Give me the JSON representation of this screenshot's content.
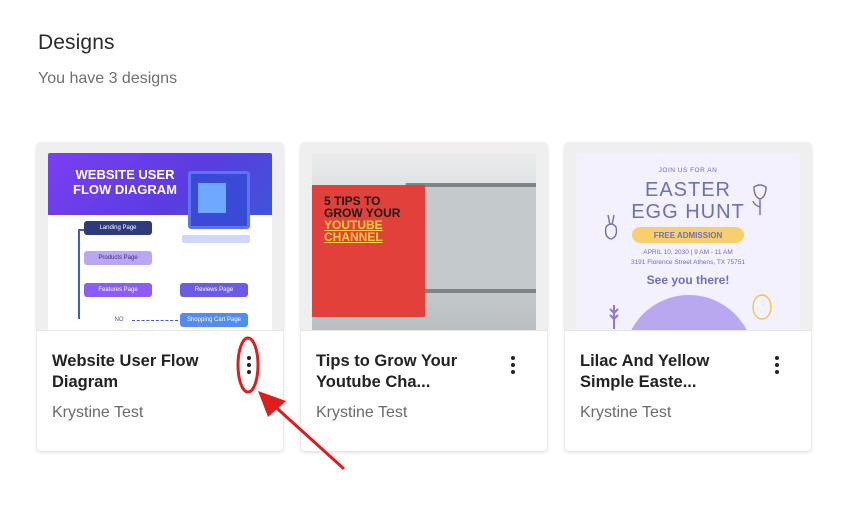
{
  "header": {
    "title": "Designs",
    "subtitle": "You have 3 designs"
  },
  "cards": [
    {
      "title": "Website User Flow Diagram",
      "author": "Krystine Test",
      "thumbnail": {
        "hero": "WEBSITE USER FLOW DIAGRAM",
        "boxes": [
          "Landing Page",
          "Products Page",
          "Features Page",
          "Reviews Page",
          "Shopping Cart Page",
          "NO"
        ]
      }
    },
    {
      "title": "Tips to Grow Your Youtube Cha...",
      "author": "Krystine Test",
      "thumbnail": {
        "line1": "5 TIPS TO",
        "line2": "GROW YOUR",
        "line3": "YOUTUBE",
        "line4": "CHANNEL"
      }
    },
    {
      "title": "Lilac And Yellow Simple Easte...",
      "author": "Krystine Test",
      "thumbnail": {
        "join": "JOIN US FOR AN",
        "line1": "EASTER",
        "line2": "EGG HUNT",
        "pill": "FREE ADMISSION",
        "date": "APRIL 10, 2030 | 9 AM - 11 AM",
        "address": "3191 Florence Street Athens, TX 75751",
        "see": "See you there!"
      }
    }
  ],
  "colors": {
    "annotation_red": "#e01d1d",
    "hero_purple": "#7b3ff2",
    "tips_red": "#e2403a",
    "easter_lilac": "#6d6fb8"
  },
  "icons": {
    "more": "more-vertical-icon"
  }
}
